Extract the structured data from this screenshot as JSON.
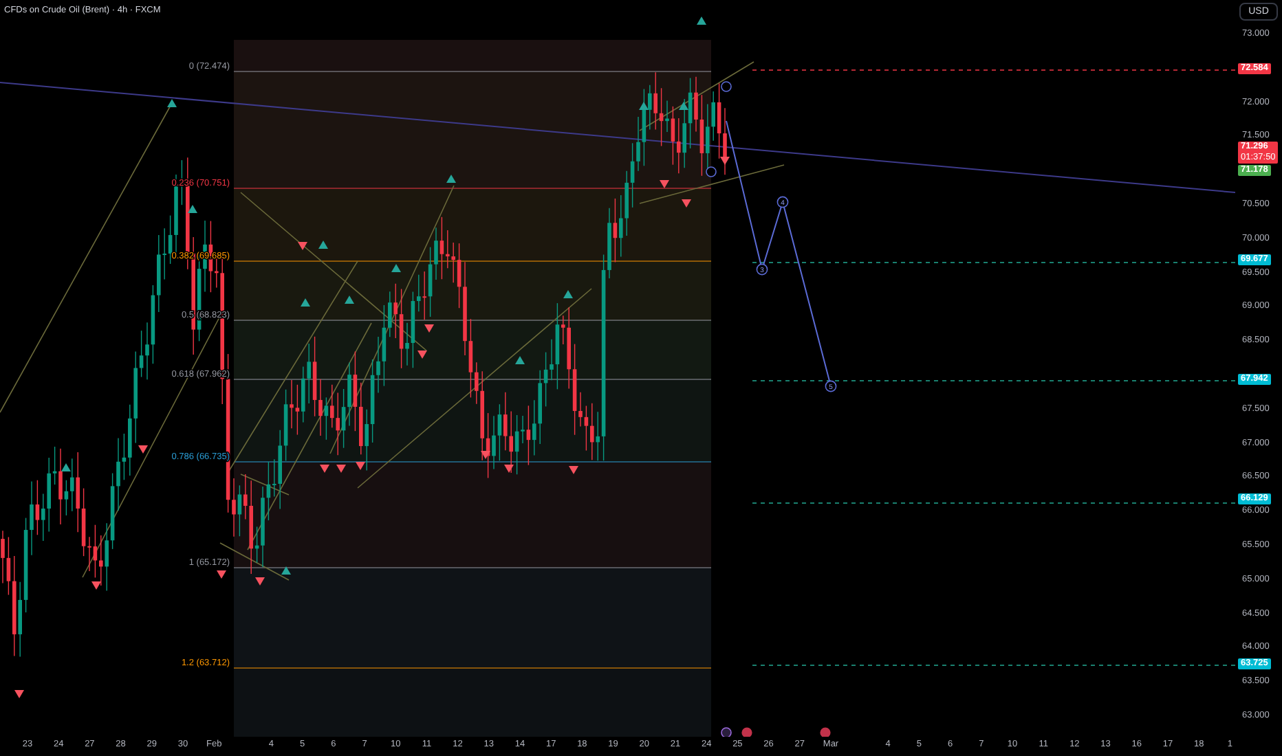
{
  "title": "CFDs on Crude Oil (Brent) · 4h · FXCM",
  "currency_button": "USD",
  "fib_levels": [
    {
      "label": "0 (72.474)",
      "color": "#9598a1"
    },
    {
      "label": "0.236 (70.751)",
      "color": "#f23645"
    },
    {
      "label": "0.382 (69.685)",
      "color": "#ff9800"
    },
    {
      "label": "0.5 (68.823)",
      "color": "#9598a1"
    },
    {
      "label": "0.618 (67.962)",
      "color": "#9598a1"
    },
    {
      "label": "0.786 (66.735)",
      "color": "#2b9fd8"
    },
    {
      "label": "1 (65.172)",
      "color": "#9598a1"
    },
    {
      "label": "1.2 (63.712)",
      "color": "#ff9800"
    }
  ],
  "wave_labels": [
    "3",
    "4",
    "5"
  ],
  "price_axis": {
    "ticks": [
      "73.000",
      "72.000",
      "71.500",
      "70.500",
      "70.000",
      "69.500",
      "69.000",
      "68.500",
      "67.500",
      "67.000",
      "66.500",
      "66.000",
      "65.500",
      "65.000",
      "64.500",
      "64.000",
      "63.500",
      "63.000"
    ],
    "badges": [
      {
        "text": "72.584",
        "color": "#f23645"
      },
      {
        "text": "71.296",
        "subtext": "01:37:50",
        "color": "#f23645"
      },
      {
        "text": "71.178",
        "color": "#4caf50"
      },
      {
        "text": "69.677",
        "color": "#00bcd4"
      },
      {
        "text": "67.942",
        "color": "#00bcd4"
      },
      {
        "text": "66.129",
        "color": "#00bcd4"
      },
      {
        "text": "63.725",
        "color": "#00bcd4"
      }
    ]
  },
  "time_axis": [
    "23",
    "24",
    "27",
    "28",
    "29",
    "30",
    "Feb",
    "4",
    "5",
    "6",
    "7",
    "10",
    "11",
    "12",
    "13",
    "14",
    "17",
    "18",
    "19",
    "20",
    "21",
    "24",
    "25",
    "26",
    "27",
    "Mar",
    "4",
    "5",
    "6",
    "7",
    "10",
    "11",
    "12",
    "13",
    "16",
    "17",
    "18",
    "1"
  ]
}
